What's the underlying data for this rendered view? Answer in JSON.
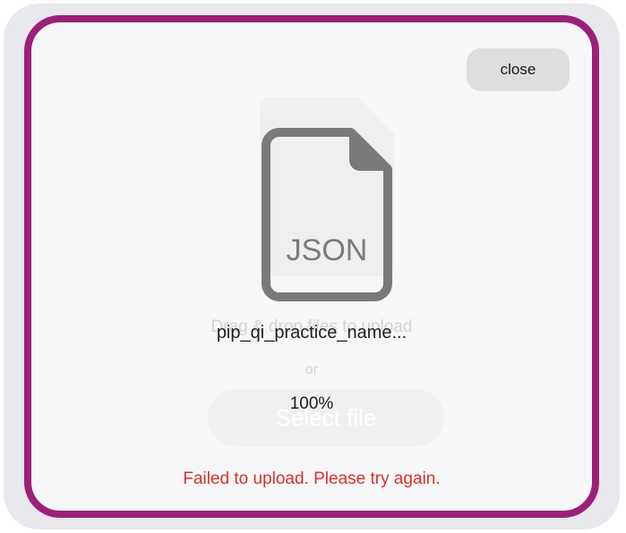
{
  "modal": {
    "close_label": "close",
    "background_ghost": {
      "file_label": "JSON",
      "drop_text": "Drag & drop files to upload",
      "or_text": "or",
      "select_label": "Select file"
    },
    "file": {
      "type_label": "JSON",
      "name": "pip_qi_practice_name...",
      "icon": "json-file-icon"
    },
    "progress_text": "100%",
    "error_text": "Failed to upload. Please try again."
  },
  "colors": {
    "border": "#9c1f7a",
    "error": "#d9302a",
    "icon": "#7a7a7a"
  }
}
